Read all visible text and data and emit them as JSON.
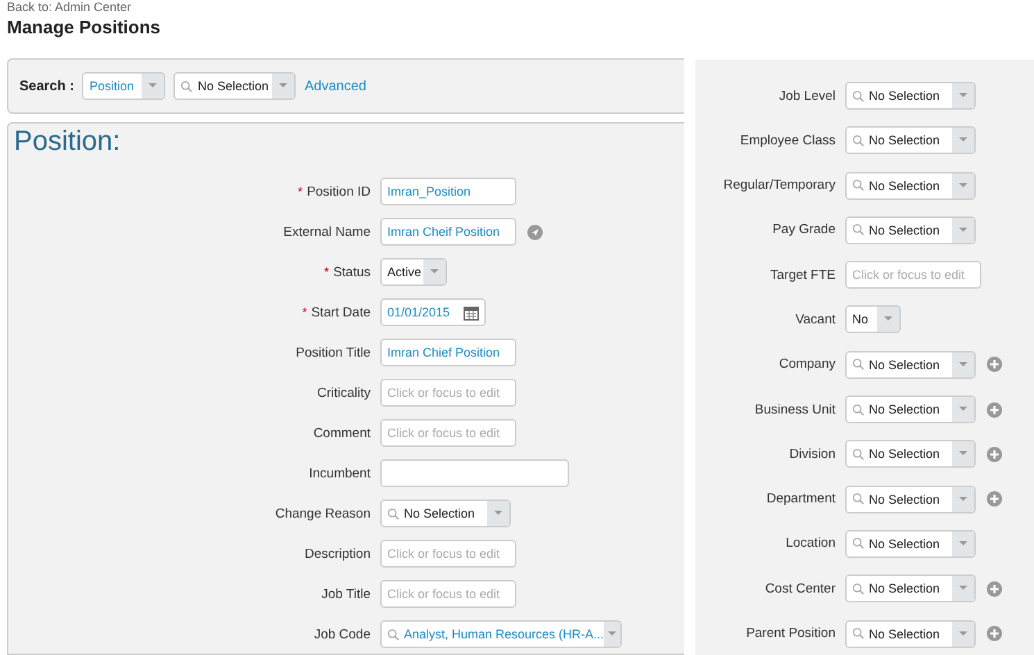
{
  "back_link": "Back to: Admin Center",
  "page_title": "Manage Positions",
  "search": {
    "label": "Search :",
    "type_select": {
      "value": "Position"
    },
    "lookup": {
      "value": "No Selection"
    },
    "advanced": "Advanced"
  },
  "position_panel": {
    "title": "Position:",
    "fields": [
      {
        "label": "Position ID",
        "required": true,
        "required_mark": "*",
        "kind": "text",
        "value": "Imran_Position",
        "info_button": false
      },
      {
        "label": "External Name",
        "required": false,
        "kind": "text",
        "value": "Imran Cheif Position",
        "info_button": true
      },
      {
        "label": "Status",
        "required": true,
        "required_mark": "*",
        "kind": "select",
        "value": "Active",
        "highlighted": false,
        "info_button": false
      },
      {
        "label": "Start Date",
        "required": true,
        "required_mark": "*",
        "kind": "date",
        "value": "01/01/2015",
        "info_button": false
      },
      {
        "label": "Position Title",
        "required": false,
        "kind": "text",
        "value": "Imran Chief Position",
        "info_button": false
      },
      {
        "label": "Criticality",
        "required": false,
        "kind": "text",
        "placeholder": "Click or focus to edit",
        "info_button": false
      },
      {
        "label": "Comment",
        "required": false,
        "kind": "text",
        "placeholder": "Click or focus to edit",
        "info_button": false
      },
      {
        "label": "Incumbent",
        "required": false,
        "kind": "wide-text",
        "info_button": false
      },
      {
        "label": "Change Reason",
        "required": false,
        "kind": "lookup",
        "value": "No Selection",
        "highlighted": false,
        "info_button": false
      },
      {
        "label": "Description",
        "required": false,
        "kind": "text",
        "placeholder": "Click or focus to edit",
        "info_button": false
      },
      {
        "label": "Job Title",
        "required": false,
        "kind": "text",
        "placeholder": "Click or focus to edit",
        "info_button": false
      },
      {
        "label": "Job Code",
        "required": false,
        "kind": "wide-lookup",
        "value": "Analyst, Human Resources (HR-A...",
        "highlighted": true,
        "info_button": false
      }
    ]
  },
  "side_panel": {
    "fields": [
      {
        "label": "Job Level",
        "required": false,
        "kind": "lookup",
        "value": "No Selection",
        "highlighted": false,
        "add_button": false
      },
      {
        "label": "Employee Class",
        "required": false,
        "kind": "lookup",
        "value": "No Selection",
        "highlighted": false,
        "add_button": false
      },
      {
        "label": "Regular/Temporary",
        "required": false,
        "kind": "lookup",
        "value": "No Selection",
        "highlighted": false,
        "add_button": false
      },
      {
        "label": "Pay Grade",
        "required": false,
        "kind": "lookup",
        "value": "No Selection",
        "highlighted": false,
        "add_button": false
      },
      {
        "label": "Target FTE",
        "required": false,
        "kind": "text",
        "placeholder": "Click or focus to edit",
        "add_button": false
      },
      {
        "label": "Vacant",
        "required": false,
        "kind": "small-select",
        "value": "No",
        "highlighted": false,
        "add_button": false
      },
      {
        "label": "Company",
        "required": false,
        "kind": "lookup",
        "value": "No Selection",
        "highlighted": false,
        "add_button": true
      },
      {
        "label": "Business Unit",
        "required": false,
        "kind": "lookup",
        "value": "No Selection",
        "highlighted": false,
        "add_button": true
      },
      {
        "label": "Division",
        "required": false,
        "kind": "lookup",
        "value": "No Selection",
        "highlighted": false,
        "add_button": true
      },
      {
        "label": "Department",
        "required": false,
        "kind": "lookup",
        "value": "No Selection",
        "highlighted": false,
        "add_button": true
      },
      {
        "label": "Location",
        "required": false,
        "kind": "lookup",
        "value": "No Selection",
        "highlighted": false,
        "add_button": false
      },
      {
        "label": "Cost Center",
        "required": false,
        "kind": "lookup",
        "value": "No Selection",
        "highlighted": false,
        "add_button": true
      },
      {
        "label": "Parent Position",
        "required": false,
        "kind": "lookup",
        "value": "No Selection",
        "highlighted": false,
        "add_button": true
      }
    ]
  }
}
